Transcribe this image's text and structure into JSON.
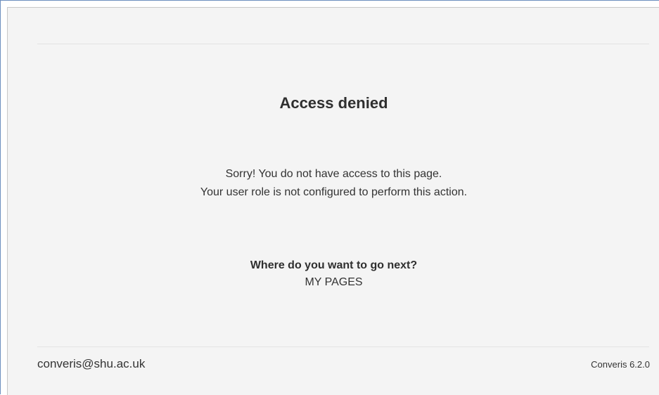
{
  "page": {
    "title": "Access denied",
    "message_line1": "Sorry! You do not have access to this page.",
    "message_line2": "Your user role is not configured to perform this action."
  },
  "navigation": {
    "heading": "Where do you want to go next?",
    "my_pages_link": "MY PAGES"
  },
  "footer": {
    "email": "converis@shu.ac.uk",
    "version": "Converis 6.2.0"
  }
}
